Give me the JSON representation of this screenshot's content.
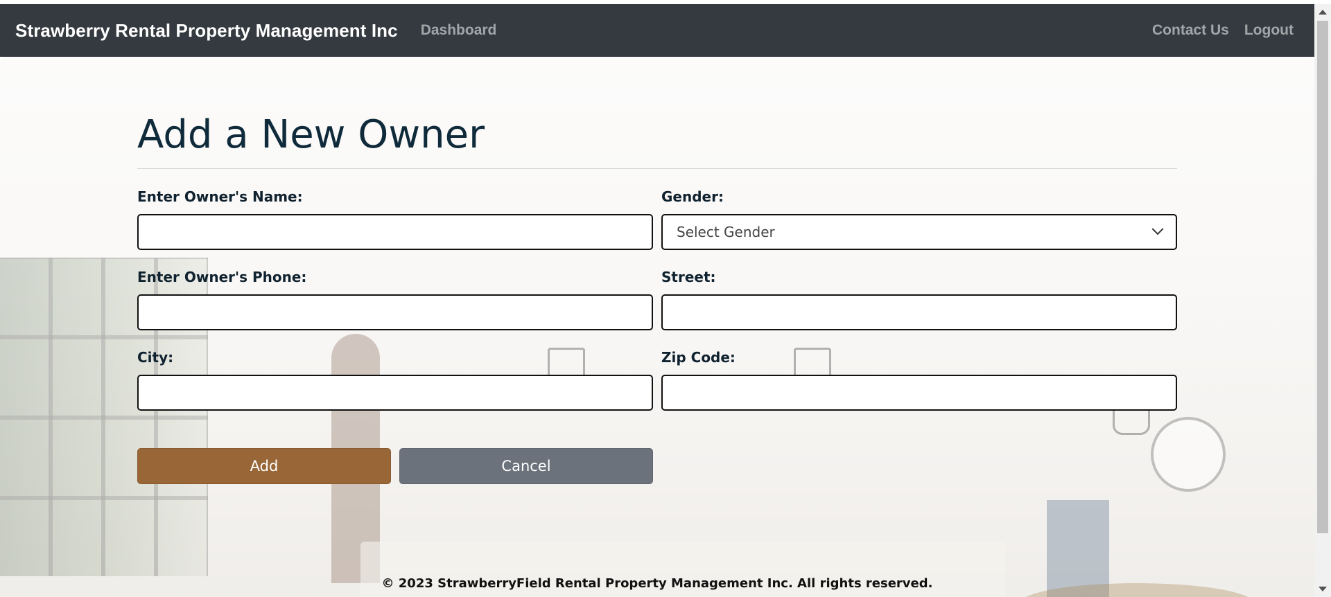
{
  "navbar": {
    "brand": "Strawberry Rental Property Management Inc",
    "dashboard_link": "Dashboard",
    "contact_link": "Contact Us",
    "logout_link": "Logout",
    "background_color": "#343a40"
  },
  "page": {
    "title": "Add a New Owner"
  },
  "form": {
    "name_label": "Enter Owner's Name:",
    "name_value": "",
    "gender_label": "Gender:",
    "gender_selected": "Select Gender",
    "phone_label": "Enter Owner's Phone:",
    "phone_value": "",
    "street_label": "Street:",
    "street_value": "",
    "city_label": "City:",
    "city_value": "",
    "zip_label": "Zip Code:",
    "zip_value": "",
    "add_button": "Add",
    "cancel_button": "Cancel",
    "add_color": "#996637",
    "cancel_color": "#6b727c"
  },
  "footer": {
    "text": "© 2023 StrawberryField Rental Property Management Inc. All rights reserved."
  },
  "icons": {
    "select_chevron": "chevron-down-icon",
    "scroll_up": "scroll-up-arrow-icon",
    "scroll_down": "scroll-down-arrow-icon"
  }
}
